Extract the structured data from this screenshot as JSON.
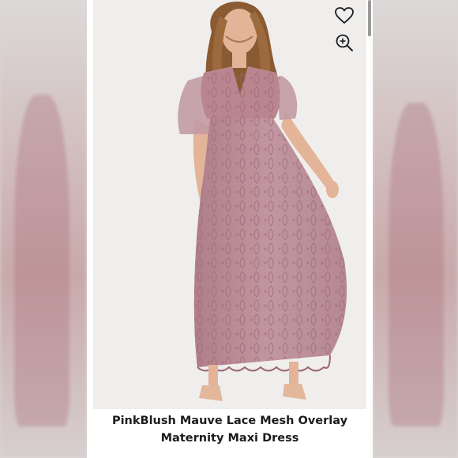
{
  "listing": {
    "title_line_1": "PinkBlush Mauve Lace Mesh Overlay",
    "title_line_2": "Maternity Maxi Dress"
  },
  "icons": {
    "favorite": "heart-outline-icon",
    "zoom": "zoom-in-icon"
  },
  "colors": {
    "dress": "#b98690",
    "lace": "#a06a77",
    "skin": "#e3b497",
    "hair": "#8a5a32",
    "shoes": "#e2b79a",
    "backdrop": "#efeeed"
  }
}
